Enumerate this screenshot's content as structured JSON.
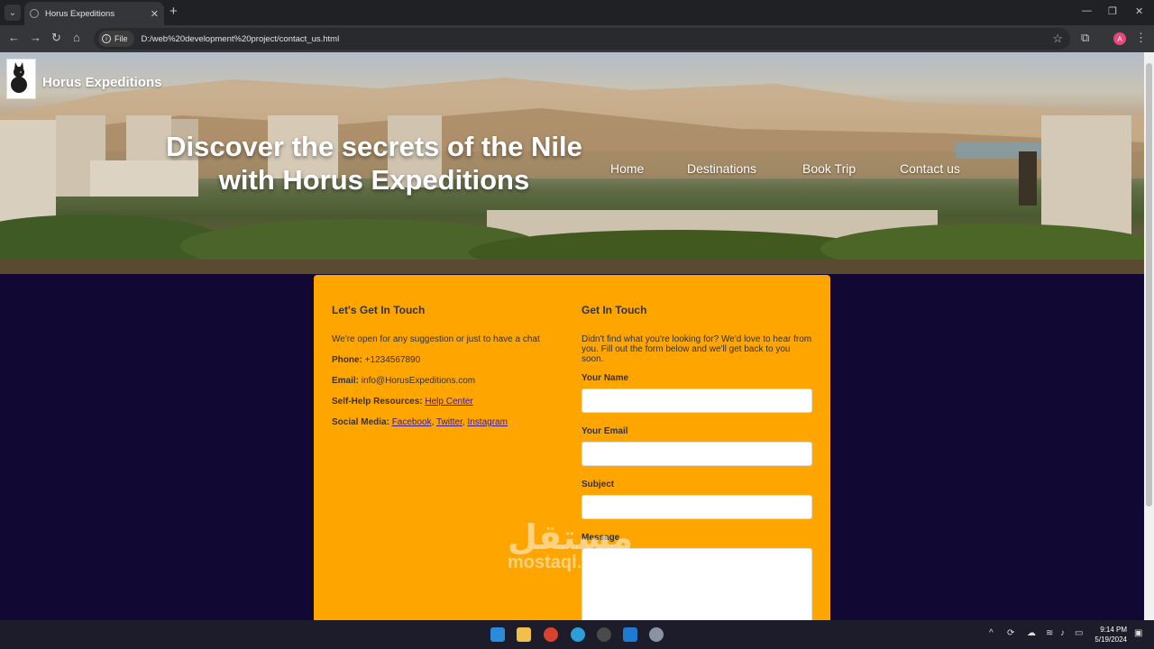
{
  "browser": {
    "tab_title": "Horus Expeditions",
    "chip_label": "File",
    "url": "D:/web%20development%20project/contact_us.html",
    "profile_initial": "A"
  },
  "site": {
    "brand": "Horus Expeditions",
    "headline": "Discover the secrets of the Nile with Horus Expeditions",
    "nav": [
      "Home",
      "Destinations",
      "Book Trip",
      "Contact us"
    ]
  },
  "contact": {
    "left_title": "Let's Get In Touch",
    "left_intro": "We're open for any suggestion or just to have a chat",
    "phone_label": "Phone:",
    "phone": "+1234567890",
    "email_label": "Email:",
    "email": "info@HorusExpeditions.com",
    "help_label": "Self-Help Resources:",
    "help_link": "Help Center",
    "social_label": "Social Media:",
    "social": [
      "Facebook",
      "Twitter",
      "Instagram"
    ]
  },
  "form": {
    "title": "Get In Touch",
    "intro": "Didn't find what you're looking for? We'd love to hear from you. Fill out the form below and we'll get back to you soon.",
    "name_label": "Your Name",
    "email_label": "Your Email",
    "subject_label": "Subject",
    "message_label": "Message"
  },
  "watermark": {
    "arabic": "مستقل",
    "latin": "mostaql.com"
  },
  "taskbar": {
    "time": "9:14 PM",
    "date": "5/19/2024"
  }
}
